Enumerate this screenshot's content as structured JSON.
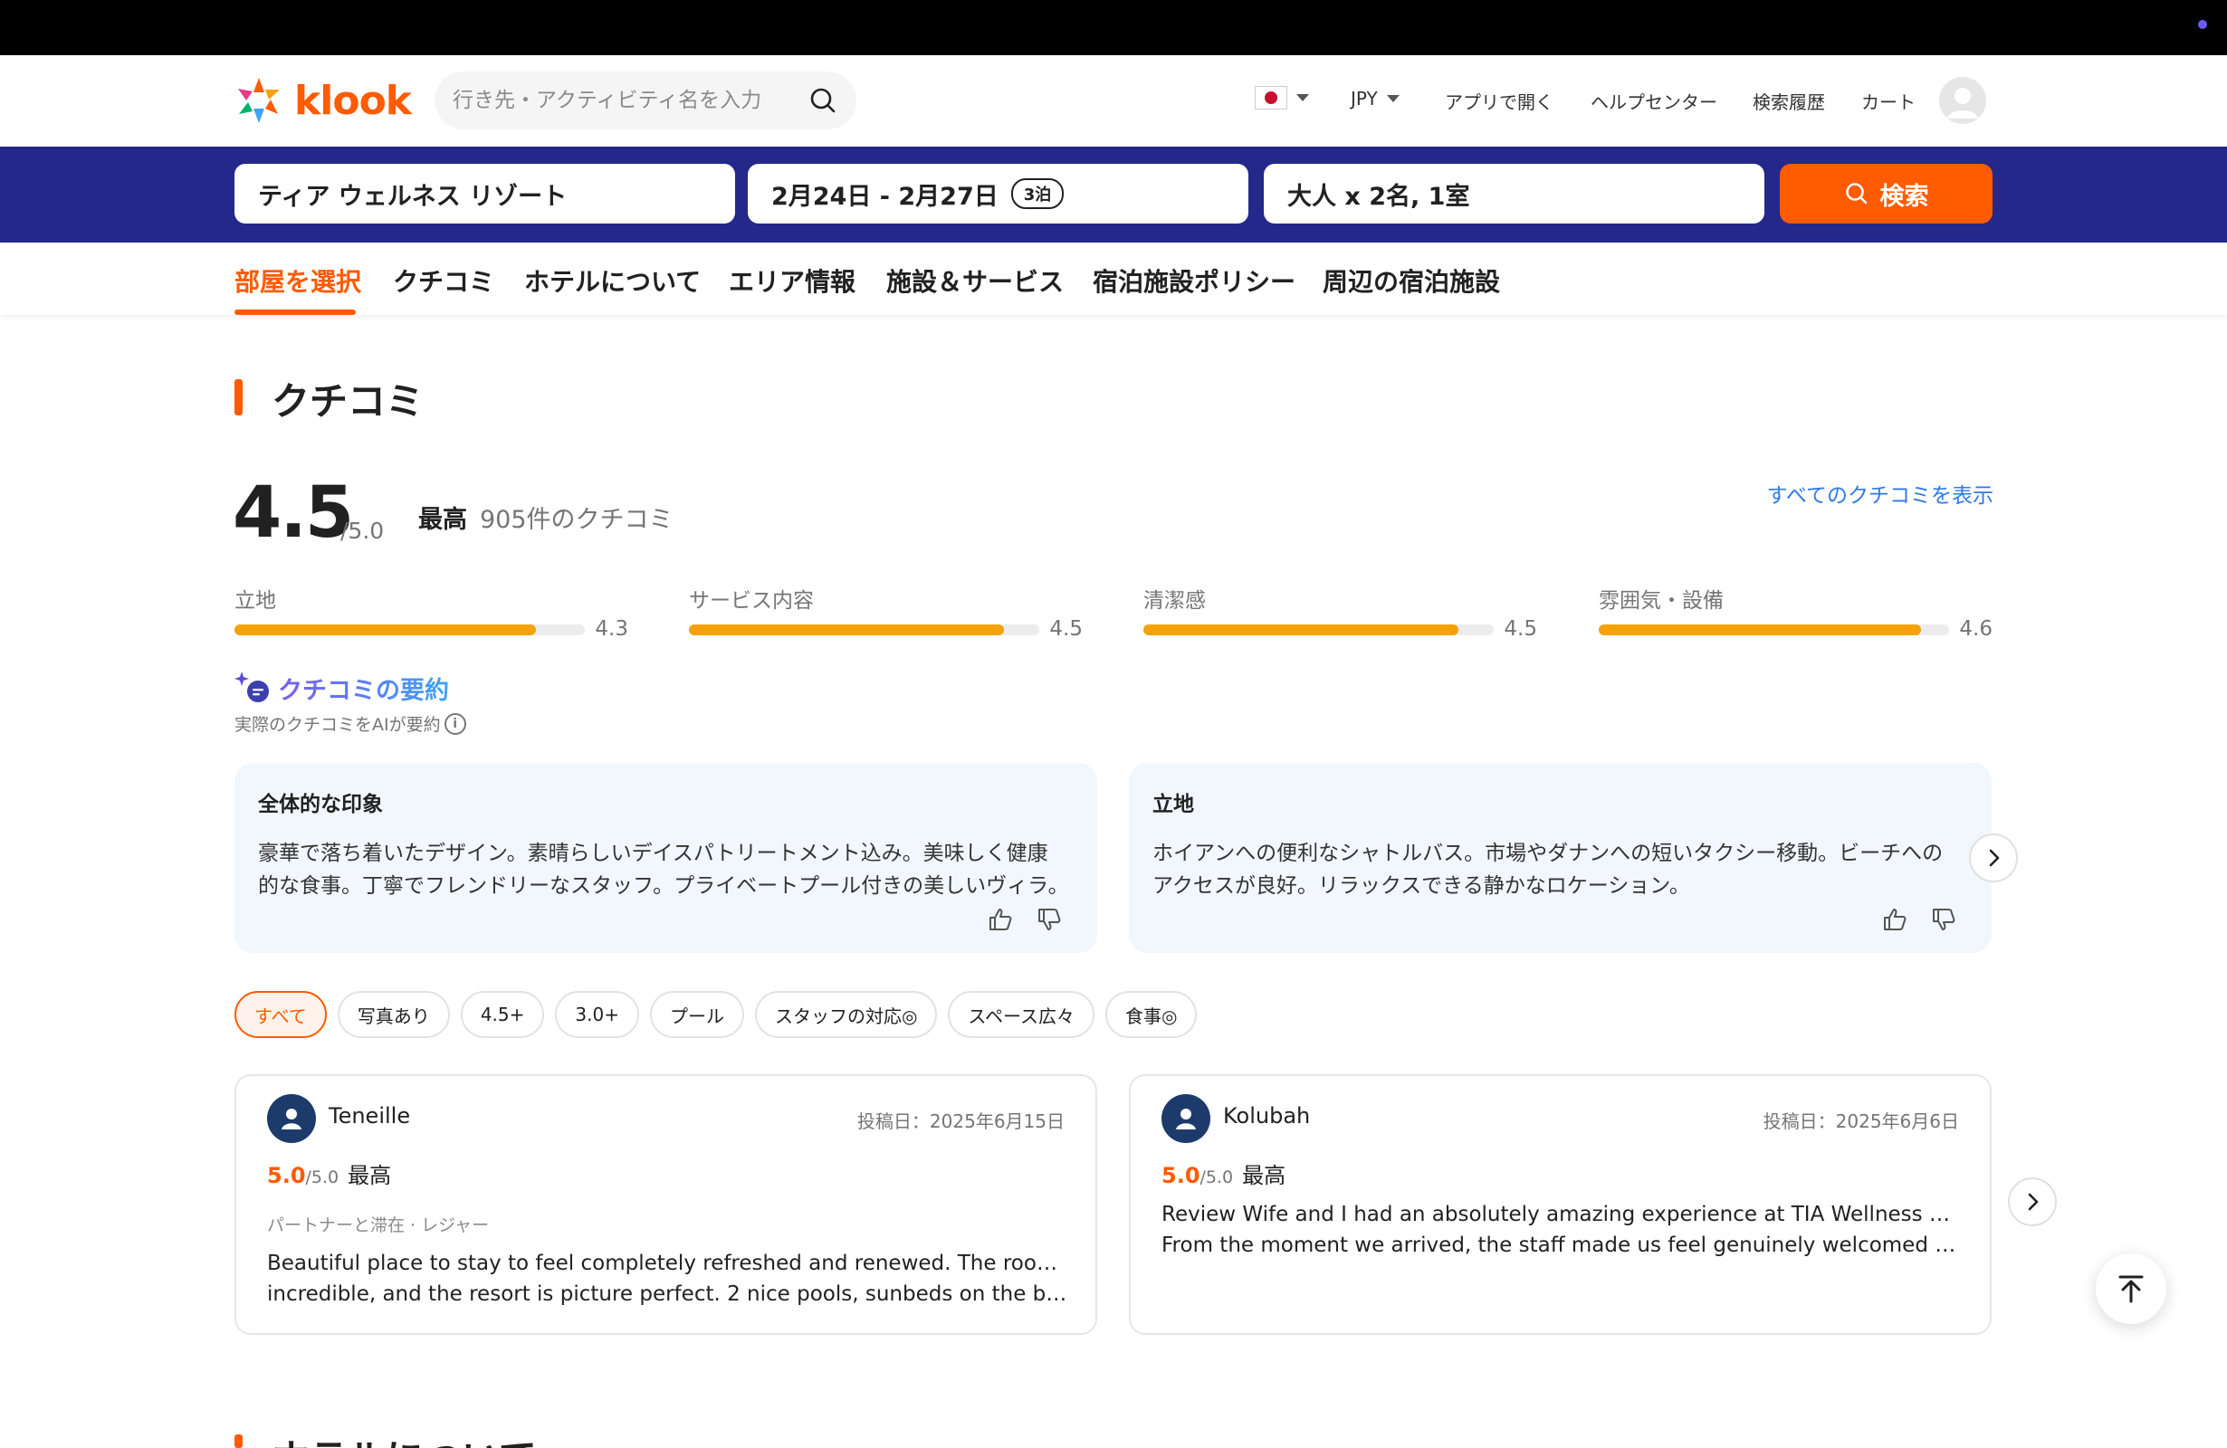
{
  "header": {
    "logo_text": "klook",
    "search_placeholder": "行き先・アクティビティ名を入力",
    "currency": "JPY",
    "links": [
      "アプリで開く",
      "ヘルプセンター",
      "検索履歴",
      "カート"
    ]
  },
  "booking": {
    "hotel": "ティア ウェルネス リゾート",
    "dates": "2月24日 - 2月27日",
    "nights": "3泊",
    "guests": "大人 x 2名, 1室",
    "search_label": "検索"
  },
  "tabs": [
    "部屋を選択",
    "クチコミ",
    "ホテルについて",
    "エリア情報",
    "施設＆サービス",
    "宿泊施設ポリシー",
    "周辺の宿泊施設"
  ],
  "reviews": {
    "section_title": "クチコミ",
    "score": "4.5",
    "score_max": "/5.0",
    "score_word": "最高",
    "count_text": "905件のクチコミ",
    "view_all": "すべてのクチコミを表示",
    "categories": [
      {
        "label": "立地",
        "value": "4.3",
        "ratio": 0.86
      },
      {
        "label": "サービス内容",
        "value": "4.5",
        "ratio": 0.9
      },
      {
        "label": "清潔感",
        "value": "4.5",
        "ratio": 0.9
      },
      {
        "label": "雰囲気・設備",
        "value": "4.6",
        "ratio": 0.92
      }
    ],
    "ai_title": "クチコミの要約",
    "ai_sub": "実際のクチコミをAIが要約",
    "summaries": [
      {
        "title": "全体的な印象",
        "lines": [
          "豪華で落ち着いたデザイン。素晴らしいデイスパトリートメント込み。美味しく健康",
          "的な食事。丁寧でフレンドリーなスタッフ。プライベートプール付きの美しいヴィラ。"
        ]
      },
      {
        "title": "立地",
        "lines": [
          "ホイアンへの便利なシャトルバス。市場やダナンへの短いタクシー移動。ビーチへの",
          "アクセスが良好。リラックスできる静かなロケーション。"
        ]
      }
    ],
    "filters": [
      "すべて",
      "写真あり",
      "4.5+",
      "3.0+",
      "プール",
      "スタッフの対応◎",
      "スペース広々",
      "食事◎"
    ],
    "cards": [
      {
        "name": "Teneille",
        "date": "投稿日：2025年6月15日",
        "score": "5.0",
        "max": "/5.0",
        "word": "最高",
        "trip": "パートナーと滞在 · レジャー",
        "lines": [
          "Beautiful place to stay to feel completely refreshed and renewed. The rooms are",
          "incredible, and the resort is picture perfect. 2 nice pools, sunbeds on the beach,..."
        ]
      },
      {
        "name": "Kolubah",
        "date": "投稿日：2025年6月6日",
        "score": "5.0",
        "max": "/5.0",
        "word": "最高",
        "trip": "",
        "lines": [
          "Review Wife and I had an absolutely amazing experience at TIA Wellness Resort.",
          "From the moment we arrived, the staff made us feel genuinely welcomed friendl..."
        ]
      }
    ]
  },
  "next_section_title": "ホテルについて",
  "colors": {
    "accent": "#ff5b00",
    "navy": "#23288a",
    "bar": "#f5a10a",
    "link": "#2f7ae5"
  }
}
